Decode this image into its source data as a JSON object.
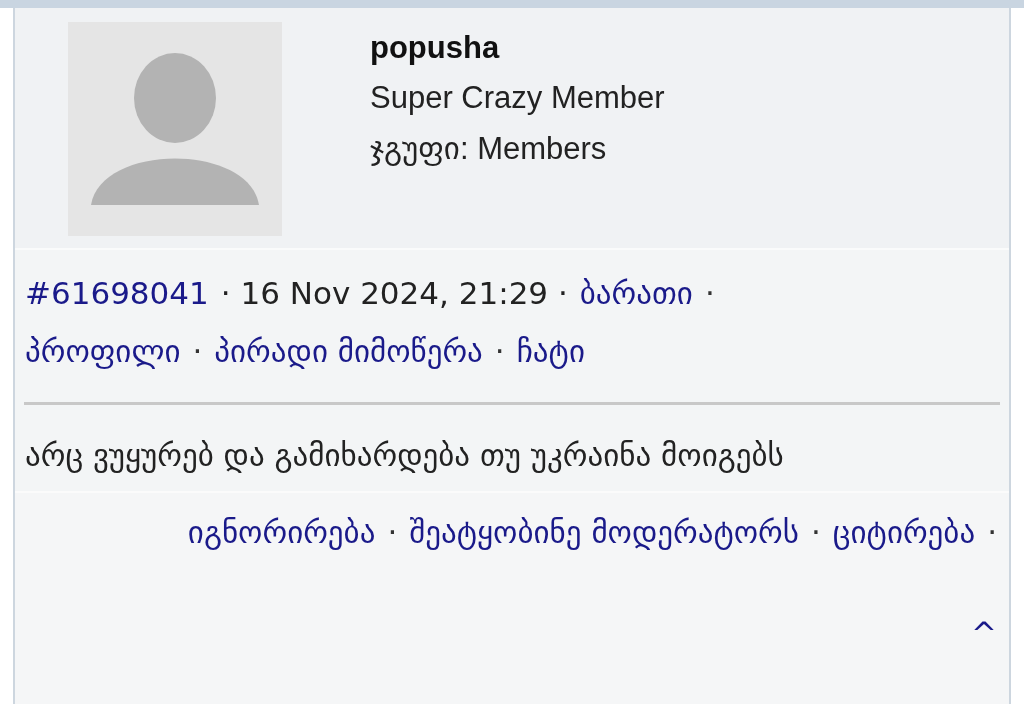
{
  "author": {
    "name": "popusha",
    "rank": "Super Crazy Member",
    "group_label": "ჯგუფი:",
    "group": "Members"
  },
  "meta": {
    "post_id": "#61698041",
    "date": "16 Nov 2024, 21:29",
    "separator": "·",
    "links": [
      "ბარათი",
      "პროფილი",
      "პირადი მიმოწერა",
      "ჩატი"
    ]
  },
  "post": {
    "text": "არც ვუყურებ და გამიხარდება თუ უკრაინა მოიგებს"
  },
  "actions": [
    "იგნორირება",
    "შეატყობინე მოდერატორს",
    "ციტირება",
    "^"
  ]
}
